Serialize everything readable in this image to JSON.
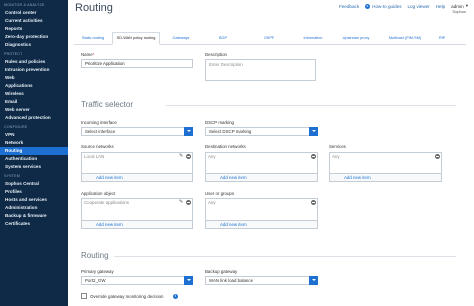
{
  "page": {
    "title": "Routing"
  },
  "header": {
    "feedback": "Feedback",
    "how_to_guides": "How-to guides",
    "log_viewer": "Log viewer",
    "help": "Help",
    "user": "admin",
    "org": "Sophos"
  },
  "sidebar": {
    "sections": [
      {
        "title": "MONITOR & ANALYZE",
        "items": [
          "Control center",
          "Current activities",
          "Reports",
          "Zero-day protection",
          "Diagnostics"
        ]
      },
      {
        "title": "PROTECT",
        "items": [
          "Rules and policies",
          "Intrusion prevention",
          "Web",
          "Applications",
          "Wireless",
          "Email",
          "Web server",
          "Advanced protection"
        ]
      },
      {
        "title": "CONFIGURE",
        "items": [
          "VPN",
          "Network",
          "Routing",
          "Authentication",
          "System services"
        ]
      },
      {
        "title": "SYSTEM",
        "items": [
          "Sophos Central",
          "Profiles",
          "Hosts and services",
          "Administration",
          "Backup & firmware",
          "Certificates"
        ]
      }
    ],
    "active": "Routing"
  },
  "tabs": [
    "Static routing",
    "SD-WAN policy routing",
    "Gateways",
    "BGP",
    "OSPF",
    "Information",
    "Upstream proxy",
    "Multicast (PIM-SM)",
    "RIP"
  ],
  "active_tab": "SD-WAN policy routing",
  "form": {
    "name_label": "Name",
    "name_value": "Prioritize Application",
    "description_label": "Description",
    "description_placeholder": "Enter Description"
  },
  "traffic_selector": {
    "title": "Traffic selector",
    "incoming_interface_label": "Incoming interface",
    "incoming_interface_value": "Select interface",
    "dscp_label": "DSCP marking",
    "dscp_value": "Select DSCP marking",
    "source_networks_label": "Source networks",
    "source_networks_item": "Local LAN",
    "destination_networks_label": "Destination networks",
    "destination_networks_item": "Any",
    "services_label": "Services",
    "services_item": "Any",
    "add_new_item": "Add new item",
    "application_object_label": "Application object",
    "application_object_item": "Cooperate applications",
    "user_groups_label": "User or groups",
    "user_groups_item": "Any"
  },
  "routing": {
    "title": "Routing",
    "primary_gateway_label": "Primary gateway",
    "primary_gateway_value": "Port2_GW",
    "backup_gateway_label": "Backup gateway",
    "backup_gateway_value": "WAN link load balance",
    "override_label": "Override gateway monitoring decision"
  },
  "colors": {
    "sidebar_bg": "#0e2a47",
    "accent": "#1d6fd1"
  }
}
